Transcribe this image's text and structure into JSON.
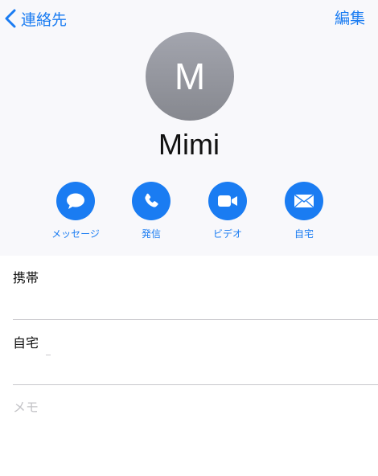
{
  "nav": {
    "back_label": "連絡先",
    "edit_label": "編集"
  },
  "contact": {
    "initial": "M",
    "name": "Mimi"
  },
  "actions": [
    {
      "label": "メッセージ",
      "icon": "message-bubble-icon"
    },
    {
      "label": "発信",
      "icon": "phone-icon"
    },
    {
      "label": "ビデオ",
      "icon": "video-camera-icon"
    },
    {
      "label": "自宅",
      "icon": "envelope-icon"
    }
  ],
  "fields": {
    "mobile_label": "携帯",
    "mobile_value": "",
    "home_label": "自宅",
    "home_value": "",
    "memo_label": "メモ"
  },
  "colors": {
    "accent": "#1a7cf2",
    "header_background": "#f8f8fb",
    "avatar_gradient_top": "#a3a5ae",
    "avatar_gradient_bottom": "#86888f"
  }
}
